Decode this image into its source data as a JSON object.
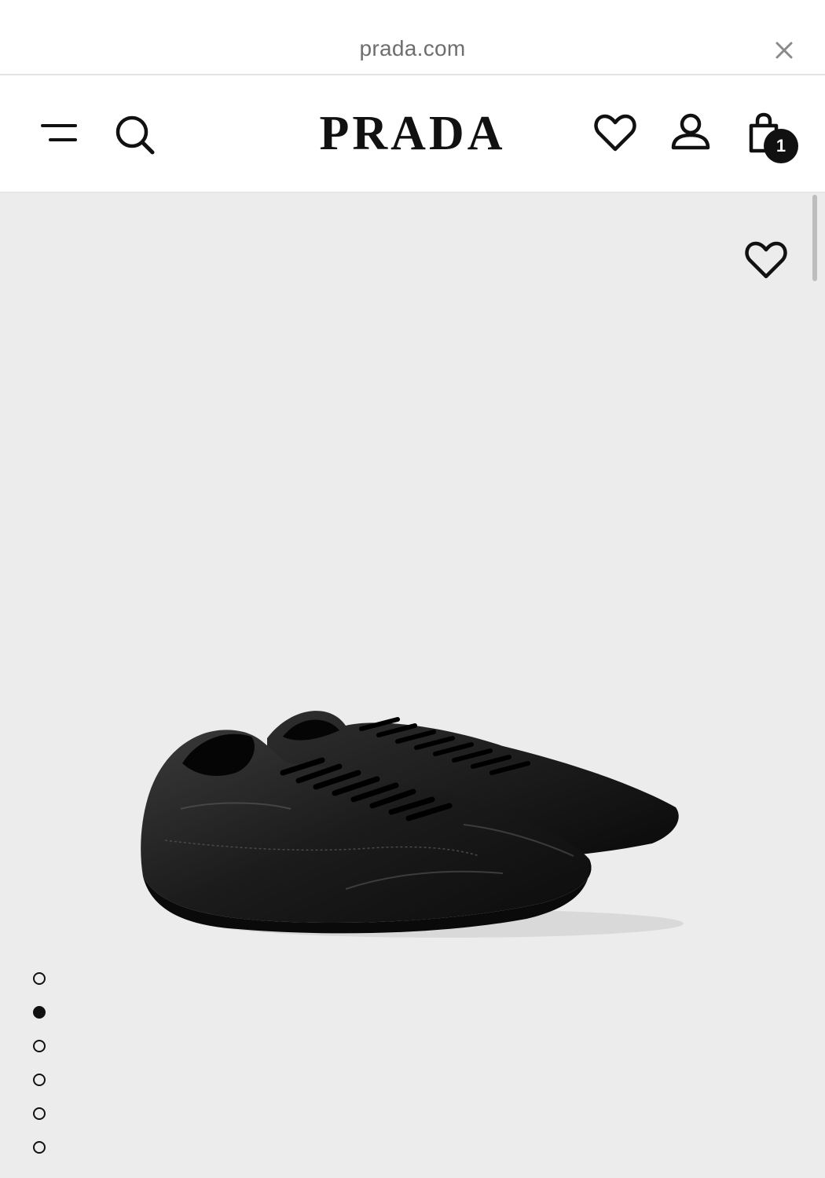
{
  "browser": {
    "url": "prada.com",
    "close_icon": "close-icon"
  },
  "header": {
    "logo_text": "PRADA",
    "menu_icon": "menu-icon",
    "search_icon": "search-icon",
    "wishlist_icon": "heart-icon",
    "account_icon": "user-icon",
    "cart_icon": "shopping-bag-icon",
    "cart_count": "1"
  },
  "product": {
    "image_alt": "black leather lace-up sneakers",
    "wishlist_icon": "heart-icon",
    "gallery_count": 6,
    "gallery_active_index": 1
  },
  "colors": {
    "background": "#ececec",
    "text": "#111111",
    "url_text": "#6e6e6e"
  }
}
